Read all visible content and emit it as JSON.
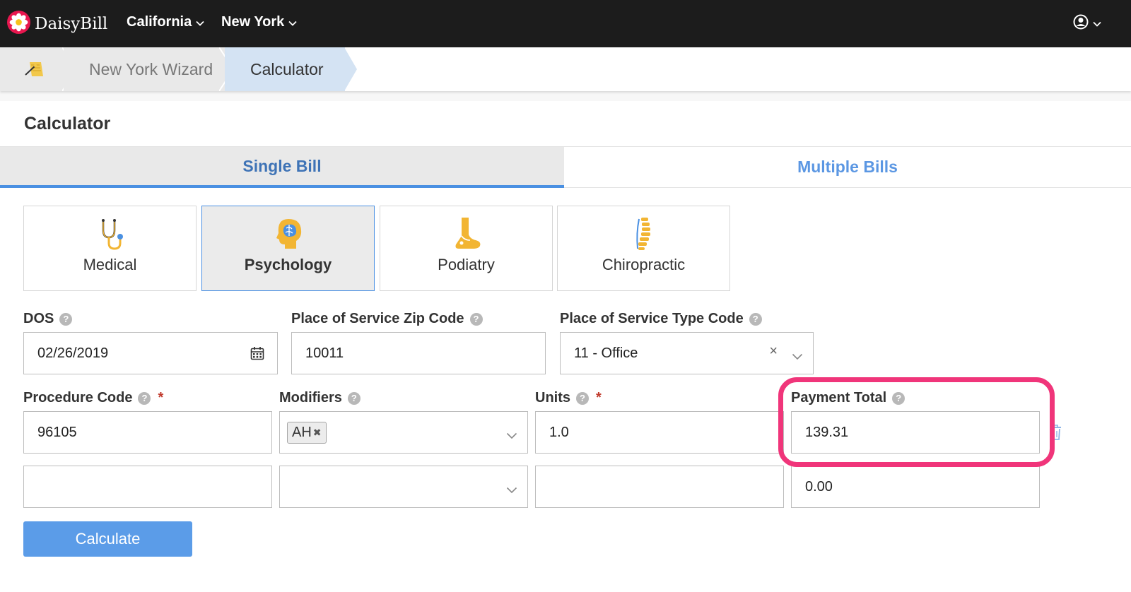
{
  "topnav": {
    "brand": "DaisyBill",
    "states": [
      {
        "label": "California"
      },
      {
        "label": "New York"
      }
    ]
  },
  "breadcrumb": {
    "wizard": "New York Wizard",
    "current": "Calculator"
  },
  "panel": {
    "title": "Calculator",
    "tabs": [
      {
        "label": "Single Bill",
        "active": true
      },
      {
        "label": "Multiple Bills",
        "active": false
      }
    ]
  },
  "categories": [
    {
      "label": "Medical",
      "icon": "stethoscope-icon",
      "selected": false
    },
    {
      "label": "Psychology",
      "icon": "brain-icon",
      "selected": true
    },
    {
      "label": "Podiatry",
      "icon": "foot-icon",
      "selected": false
    },
    {
      "label": "Chiropractic",
      "icon": "spine-icon",
      "selected": false
    }
  ],
  "fields": {
    "dos": {
      "label": "DOS",
      "value": "02/26/2019"
    },
    "zip": {
      "label": "Place of Service Zip Code",
      "value": "10011"
    },
    "type_code": {
      "label": "Place of Service Type Code",
      "value": "11 - Office"
    },
    "procedure": {
      "label": "Procedure Code",
      "required": "*"
    },
    "modifiers": {
      "label": "Modifiers"
    },
    "units": {
      "label": "Units",
      "required": "*"
    },
    "payment": {
      "label": "Payment Total"
    }
  },
  "rows": [
    {
      "procedure": "96105",
      "modifiers": [
        "AH"
      ],
      "units": "1.0",
      "payment": "139.31"
    },
    {
      "procedure": "",
      "modifiers": [],
      "units": "",
      "payment": "0.00"
    }
  ],
  "actions": {
    "calculate": "Calculate"
  },
  "colors": {
    "accent": "#4a90e2",
    "highlight": "#f0357a",
    "brand_icon": "#e8174f"
  }
}
